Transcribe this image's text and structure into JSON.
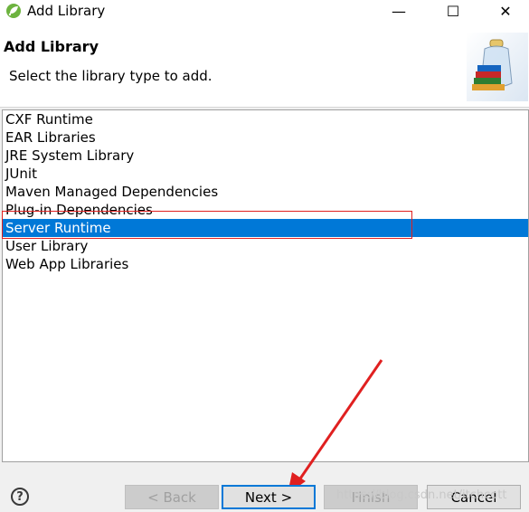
{
  "window": {
    "title": "Add Library",
    "minimize_glyph": "—",
    "maximize_glyph": "☐",
    "close_glyph": "✕",
    "icon": "spring-leaf-icon"
  },
  "header": {
    "title": "Add Library",
    "message": "Select the library type to add.",
    "image": "library-jar-books-icon"
  },
  "library_types": {
    "items": [
      {
        "label": "CXF Runtime",
        "selected": false
      },
      {
        "label": "EAR Libraries",
        "selected": false
      },
      {
        "label": "JRE System Library",
        "selected": false
      },
      {
        "label": "JUnit",
        "selected": false
      },
      {
        "label": "Maven Managed Dependencies",
        "selected": false
      },
      {
        "label": "Plug-in Dependencies",
        "selected": false
      },
      {
        "label": "Server Runtime",
        "selected": true
      },
      {
        "label": "User Library",
        "selected": false
      },
      {
        "label": "Web App Libraries",
        "selected": false
      }
    ]
  },
  "buttons": {
    "help_glyph": "?",
    "back": "< Back",
    "next": "Next >",
    "finish": "Finish",
    "cancel": "Cancel"
  },
  "watermark": "https://blog.csdn.net/itchcott",
  "colors": {
    "selection": "#0078d7",
    "annotation": "#e02020"
  }
}
